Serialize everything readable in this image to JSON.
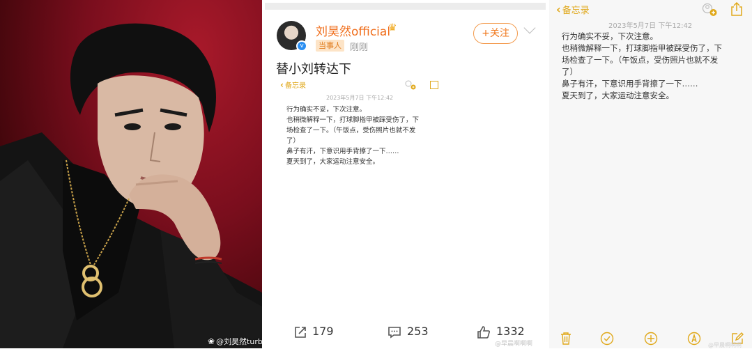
{
  "photo": {
    "watermark": "@刘昊然turbo",
    "watermark_logo": "weibo-logo-icon"
  },
  "weibo": {
    "user_name": "刘昊然official",
    "role_badge": "当事人",
    "post_time": "刚刚",
    "follow_label": "+关注",
    "post_text": "替小刘转达下",
    "embedded_memo": {
      "back_label": "备忘录",
      "date": "2023年5月7日 下午12:42",
      "lines": [
        "行为确实不妥，下次注意。",
        "也稍微解释一下，打球脚指甲被踩受伤了，下",
        "场检查了一下。（午饭点，受伤照片也就不发",
        "了）",
        "鼻子有汗，下意识用手背擦了一下……",
        "夏天到了，大家运动注意安全。"
      ]
    },
    "actions": {
      "repost_count": "179",
      "comment_count": "253",
      "like_count": "1332"
    },
    "watermark": "@早晨啊啊啊"
  },
  "memo": {
    "back_label": "备忘录",
    "date": "2023年5月7日 下午12:42",
    "lines": [
      "行为确实不妥，下次注意。",
      "也稍微解释一下，打球脚指甲被踩受伤了，下",
      "场检查了一下。（午饭点，受伤照片也就不发",
      "了）",
      "鼻子有汗，下意识用手背擦了一下……",
      "夏天到了，大家运动注意安全。"
    ],
    "watermark": "@早晨啊啊啊"
  },
  "colors": {
    "accent_orange": "#f06d1a",
    "memo_gold": "#e0a81a",
    "photo_red": "#8b1020"
  }
}
